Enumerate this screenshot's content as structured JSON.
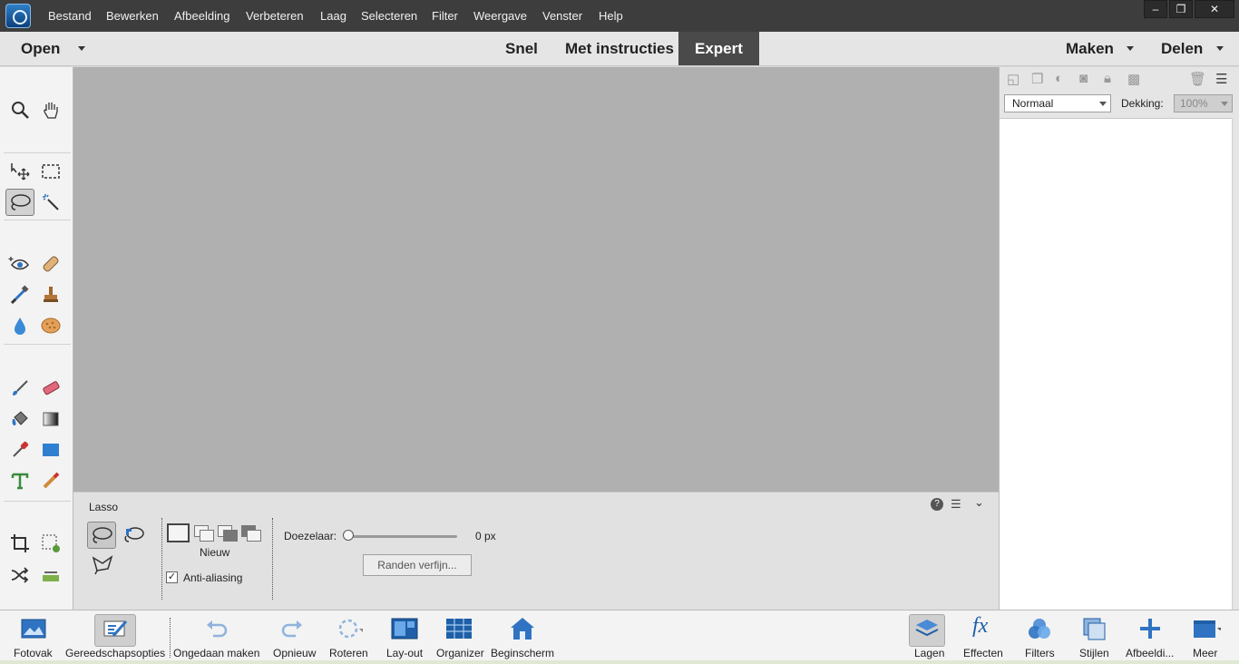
{
  "menubar": {
    "items": [
      "Bestand",
      "Bewerken",
      "Afbeelding",
      "Verbeteren",
      "Laag",
      "Selecteren",
      "Filter",
      "Weergave",
      "Venster",
      "Help"
    ],
    "window_controls": {
      "minimize": "–",
      "restore": "❐",
      "close": "✕"
    }
  },
  "modebar": {
    "open_label": "Open",
    "tabs": [
      "Snel",
      "Met instructies",
      "Expert"
    ],
    "active_tab": "Expert",
    "make_label": "Maken",
    "share_label": "Delen"
  },
  "toolbox": {
    "active_tool": "lasso-tool",
    "tools": [
      "zoom-tool",
      "hand-tool",
      "move-tool",
      "marquee-tool",
      "lasso-tool",
      "quick-selection-tool",
      "red-eye-tool",
      "spot-healing-tool",
      "smart-brush-tool",
      "clone-stamp-tool",
      "blur-tool",
      "sponge-tool",
      "brush-tool",
      "eraser-tool",
      "paint-bucket-tool",
      "gradient-tool",
      "eyedropper-tool",
      "shape-tool",
      "type-tool",
      "pencil-tool",
      "crop-tool",
      "recompose-tool",
      "content-aware-move-tool",
      "straighten-tool"
    ]
  },
  "tool_options": {
    "tool_name": "Lasso",
    "selection_mode_label": "Nieuw",
    "anti_alias_label": "Anti-aliasing",
    "anti_alias_checked": true,
    "feather_label": "Doezelaar:",
    "feather_value": "0 px",
    "feather_fraction": 0,
    "refine_button": "Randen verfijn..."
  },
  "layers_panel": {
    "blend_mode": "Normaal",
    "opacity_label": "Dekking:",
    "opacity_value": "100%"
  },
  "bottombar": {
    "left": [
      {
        "name": "photo-bin",
        "label": "Fotovak"
      },
      {
        "name": "tool-options",
        "label": "Gereedschapsopties"
      },
      {
        "name": "undo",
        "label": "Ongedaan maken"
      },
      {
        "name": "redo",
        "label": "Opnieuw"
      },
      {
        "name": "rotate",
        "label": "Roteren"
      },
      {
        "name": "layout",
        "label": "Lay-out"
      },
      {
        "name": "organizer",
        "label": "Organizer"
      },
      {
        "name": "home-screen",
        "label": "Beginscherm"
      }
    ],
    "right": [
      {
        "name": "layers",
        "label": "Lagen"
      },
      {
        "name": "effects",
        "label": "Effecten"
      },
      {
        "name": "filters",
        "label": "Filters"
      },
      {
        "name": "styles",
        "label": "Stijlen"
      },
      {
        "name": "graphics",
        "label": "Afbeeldi..."
      },
      {
        "name": "more",
        "label": "Meer"
      }
    ]
  },
  "colors": {
    "menubar_bg": "#3d3d3d",
    "canvas_bg": "#b0b0b0",
    "active_tab_bg": "#4a4a4a",
    "icon_blue": "#2f73c2"
  }
}
